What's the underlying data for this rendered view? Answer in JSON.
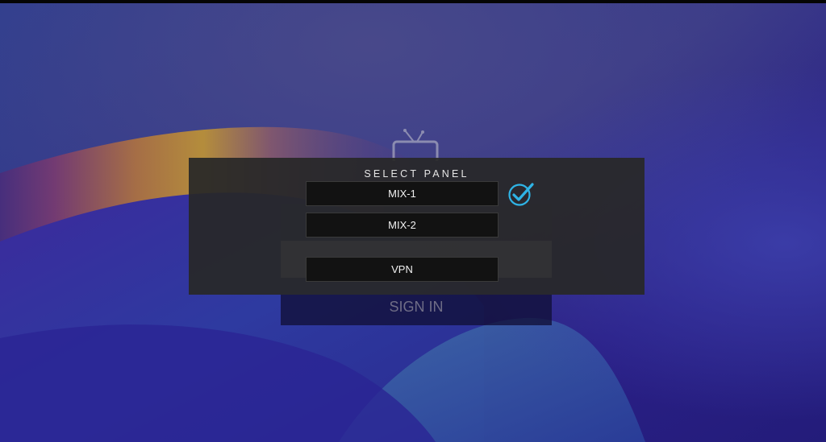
{
  "dialog": {
    "title": "SELECT PANEL",
    "options": [
      {
        "label": "MIX-1",
        "selected": true
      },
      {
        "label": "MIX-2",
        "selected": false
      },
      {
        "label": "VPN",
        "selected": false
      }
    ],
    "selected_indicator_icon": "check-circle-icon"
  },
  "login": {
    "signin_label": "SIGN IN"
  },
  "app": {
    "logo_icon": "tv-antenna-icon"
  },
  "colors": {
    "background_primary": "#2b2a8a",
    "background_accent": "#c99a2e",
    "dialog_bg": "#282828",
    "option_bg": "#121212",
    "check_accent": "#2fb4e6"
  }
}
